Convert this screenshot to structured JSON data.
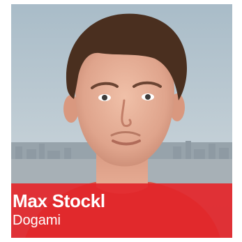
{
  "profile": {
    "name": "Max Stockl",
    "company": "Dogami"
  },
  "colors": {
    "caption_band": "#e2262a",
    "caption_text": "#ffffff",
    "sky": "#b8c6cf",
    "skin": "#e7b29c",
    "hair": "#4a2f1f"
  },
  "photo": {
    "icon": "person-portrait"
  }
}
